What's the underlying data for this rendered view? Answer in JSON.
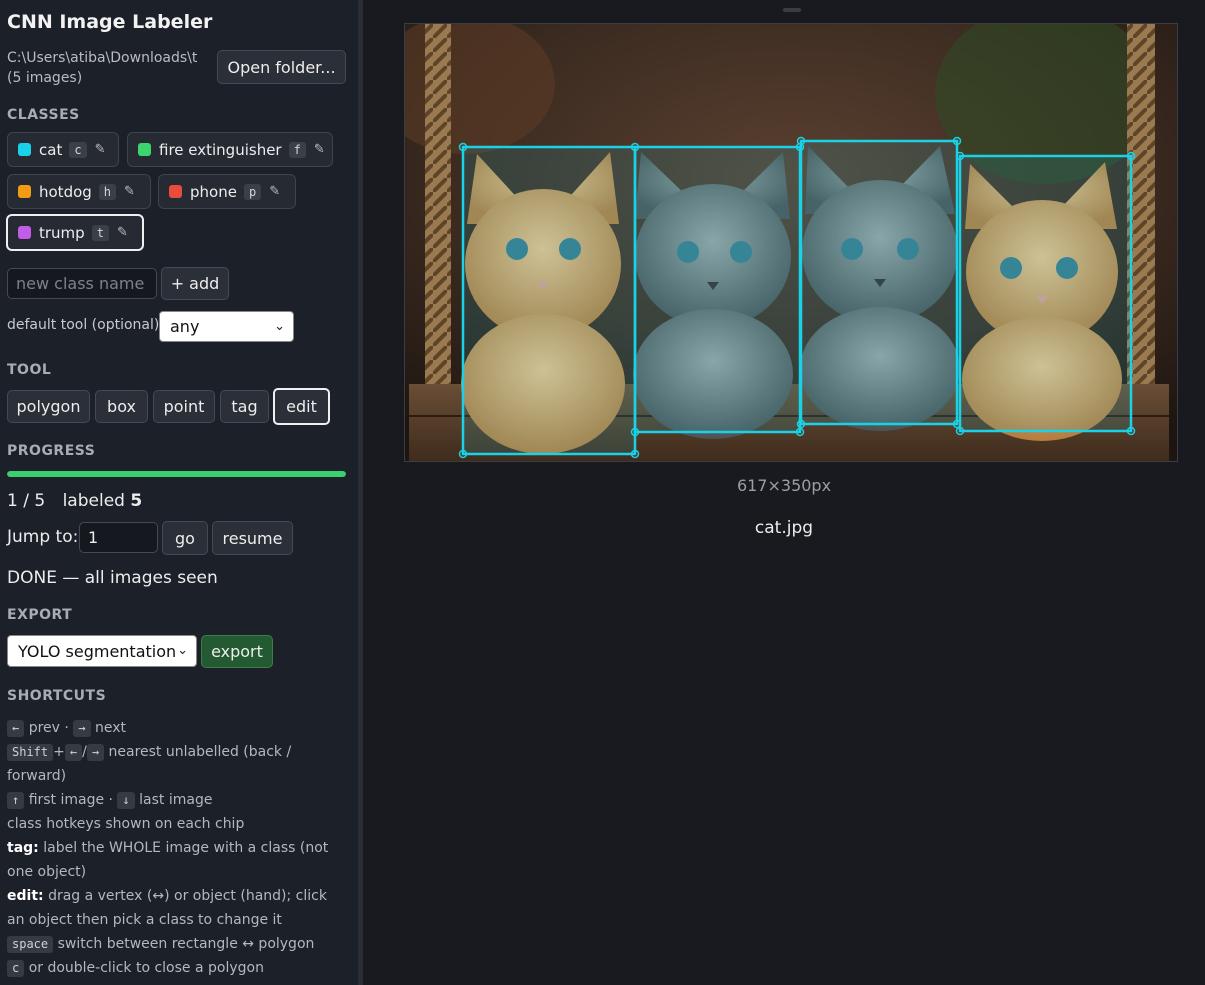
{
  "app": {
    "title": "CNN Image Labeler"
  },
  "folder": {
    "path": "C:\\Users\\atiba\\Downloads\\t (5 images)",
    "open_button": "Open folder..."
  },
  "classes": {
    "heading": "CLASSES",
    "items": [
      {
        "name": "cat",
        "hotkey": "c",
        "color": "#1ad2e8",
        "active": false
      },
      {
        "name": "fire extinguisher",
        "hotkey": "f",
        "color": "#3bd46e",
        "active": false
      },
      {
        "name": "hotdog",
        "hotkey": "h",
        "color": "#f39c12",
        "active": false
      },
      {
        "name": "phone",
        "hotkey": "p",
        "color": "#e74c3c",
        "active": false
      },
      {
        "name": "trump",
        "hotkey": "t",
        "color": "#c35ce8",
        "active": true
      }
    ],
    "new_class_placeholder": "new class name",
    "add_button": "+ add",
    "default_tool_label": "default tool (optional):",
    "default_tool_value": "any"
  },
  "tool": {
    "heading": "TOOL",
    "buttons": [
      "polygon",
      "box",
      "point",
      "tag",
      "edit"
    ],
    "active": "edit"
  },
  "progress": {
    "heading": "PROGRESS",
    "fraction": 1.0,
    "position": "1 / 5",
    "labeled_label": "labeled",
    "labeled_count": "5",
    "jump_label": "Jump to:",
    "jump_value": "1",
    "go_button": "go",
    "resume_button": "resume",
    "status": "DONE — all images seen"
  },
  "export": {
    "heading": "EXPORT",
    "format": "YOLO segmentation",
    "button": "export"
  },
  "shortcuts": {
    "heading": "SHORTCUTS",
    "prev": "prev",
    "next": "next",
    "shift": "Shift",
    "nearest": "nearest unlabelled (back / forward)",
    "first": "first image",
    "last": "last image",
    "hotkeys_note": "class hotkeys shown on each chip",
    "tag_label": "tag:",
    "tag_text": "label the WHOLE image with a class (not one object)",
    "edit_label": "edit:",
    "edit_text": "drag a vertex (↔) or object (hand); click an object then pick a class to change it",
    "space_key": "space",
    "space_text": "switch between rectangle ↔ polygon",
    "c_key": "c",
    "c_text": "or double-click to close a polygon"
  },
  "image": {
    "dimensions": "617×350px",
    "filename": "cat.jpg",
    "box_color": "#1ad2e8"
  }
}
